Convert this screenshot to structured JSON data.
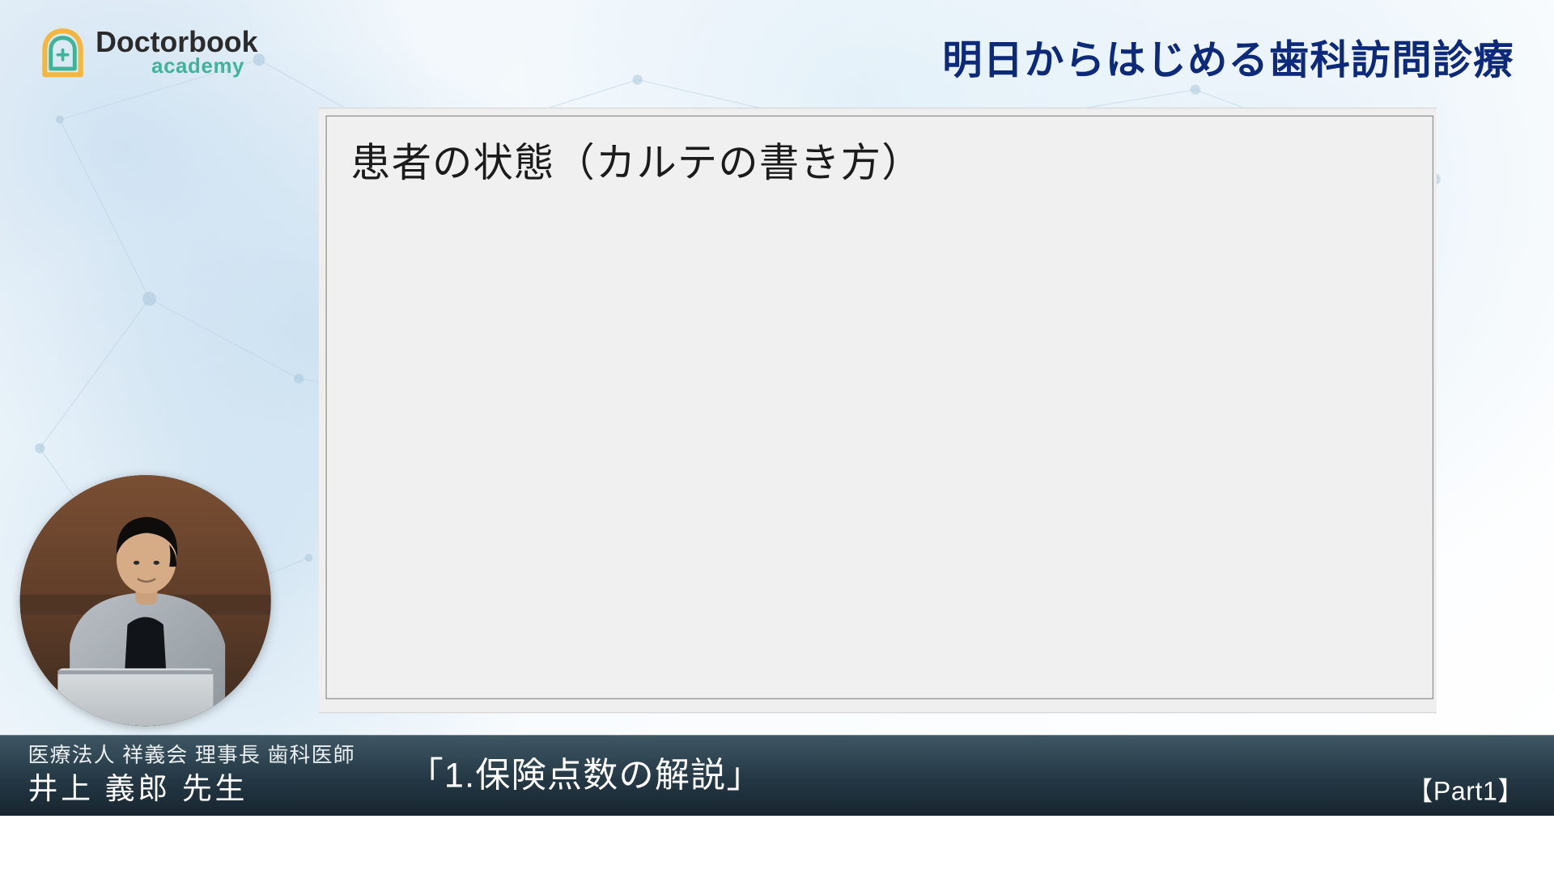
{
  "logo": {
    "line1": "Doctorbook",
    "line2": "academy"
  },
  "course_title": "明日からはじめる歯科訪問診療",
  "slide": {
    "heading": "患者の状態（カルテの書き方）"
  },
  "presenter": {
    "affiliation": "医療法人 祥義会 理事長 歯科医師",
    "name": "井上 義郎 先生"
  },
  "section_title": "「1.保険点数の解説」",
  "part_label": "【Part1】"
}
